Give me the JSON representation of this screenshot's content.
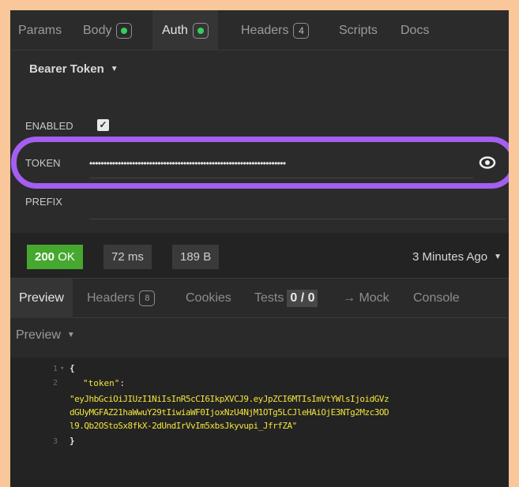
{
  "request_tabs": {
    "params": "Params",
    "body": "Body",
    "auth": "Auth",
    "headers": "Headers",
    "headers_count": "4",
    "scripts": "Scripts",
    "docs": "Docs"
  },
  "auth": {
    "type": "Bearer Token",
    "enabled_label": "ENABLED",
    "enabled": true,
    "token_label": "TOKEN",
    "token_value": "•••••••••••••••••••••••••••••••••••••••••••••••••••••••••••••••••••••",
    "prefix_label": "PREFIX",
    "prefix_value": ""
  },
  "status": {
    "code": "200",
    "text": "OK",
    "time": "72 ms",
    "size": "189 B",
    "time_ago": "3 Minutes Ago"
  },
  "response_tabs": {
    "preview": "Preview",
    "headers": "Headers",
    "headers_count": "8",
    "cookies": "Cookies",
    "tests": "Tests",
    "tests_value": "0 / 0",
    "mock": "→ Mock",
    "console": "Console"
  },
  "preview_mode": "Preview",
  "code": {
    "line_numbers": [
      "1",
      "2",
      "3"
    ],
    "open_brace": "{",
    "key": "\"token\"",
    "colon": ":",
    "value_lines": [
      "\"eyJhbGciOiJIUzI1NiIsInR5cCI6IkpXVCJ9.eyJpZCI6MTIsImVtYWlsIjoidGVz",
      "dGUyMGFAZ21haWwuY29tIiwiaWF0IjoxNzU4NjM1OTg5LCJleHAiOjE3NTg2Mzc3OD",
      "l9.Qb2OStoSx8fkX-2dUndIrVvIm5xbsJkyvupi_JfrfZA\""
    ],
    "close_brace": "}"
  },
  "colors": {
    "background": "#f9c79a",
    "highlight": "#a45ef0",
    "status_ok": "#46a82e",
    "indicator": "#34d05a",
    "json_string": "#f2e53c"
  }
}
